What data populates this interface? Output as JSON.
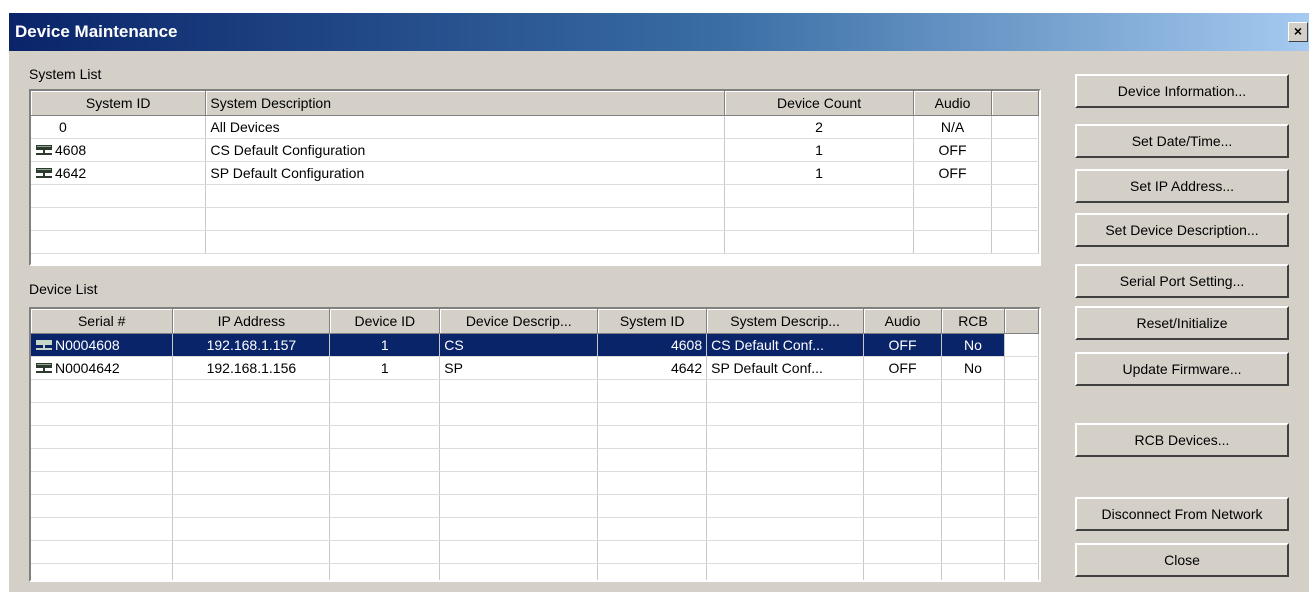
{
  "window": {
    "title": "Device Maintenance",
    "close_label": "×"
  },
  "system_list": {
    "label": "System List",
    "columns": [
      "System ID",
      "System Description",
      "Device Count",
      "Audio"
    ],
    "rows": [
      {
        "id": "0",
        "description": "All Devices",
        "count": "2",
        "audio": "N/A",
        "icon": ""
      },
      {
        "id": "4608",
        "description": "CS Default Configuration",
        "count": "1",
        "audio": "OFF",
        "icon": "network-device-icon"
      },
      {
        "id": "4642",
        "description": "SP Default Configuration",
        "count": "1",
        "audio": "OFF",
        "icon": "network-device-icon"
      }
    ]
  },
  "device_list": {
    "label": "Device List",
    "columns": [
      "Serial #",
      "IP Address",
      "Device ID",
      "Device Descrip...",
      "System ID",
      "System Descrip...",
      "Audio",
      "RCB"
    ],
    "rows": [
      {
        "serial": "N0004608",
        "ip": "192.168.1.157",
        "device_id": "1",
        "device_desc": "CS",
        "system_id": "4608",
        "system_desc": "CS Default Conf...",
        "audio": "OFF",
        "rcb": "No",
        "selected": true
      },
      {
        "serial": "N0004642",
        "ip": "192.168.1.156",
        "device_id": "1",
        "device_desc": "SP",
        "system_id": "4642",
        "system_desc": "SP Default Conf...",
        "audio": "OFF",
        "rcb": "No",
        "selected": false
      }
    ]
  },
  "buttons": {
    "device_information": "Device Information...",
    "set_date_time": "Set Date/Time...",
    "set_ip_address": "Set IP Address...",
    "set_device_description": "Set Device Description...",
    "serial_port_setting": "Serial Port Setting...",
    "reset_initialize": "Reset/Initialize",
    "update_firmware": "Update Firmware...",
    "rcb_devices": "RCB Devices...",
    "disconnect_from_network": "Disconnect From Network",
    "close": "Close"
  },
  "colors": {
    "title_start": "#0a246a",
    "title_end": "#a6caf0",
    "face": "#d4d0c8",
    "selection": "#0a246a"
  }
}
